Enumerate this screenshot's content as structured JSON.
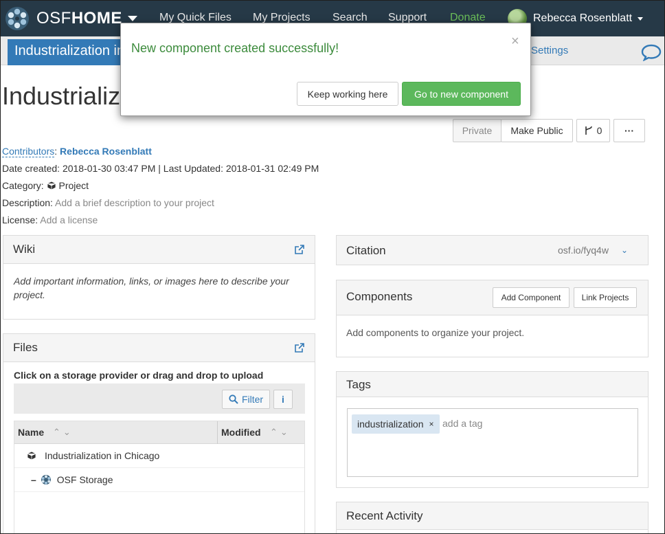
{
  "navbar": {
    "brand_prefix": "OSF",
    "brand_suffix": "HOME",
    "links": {
      "quick_files": "My Quick Files",
      "projects": "My Projects",
      "search": "Search",
      "support": "Support",
      "donate": "Donate"
    },
    "user_name": "Rebecca Rosenblatt"
  },
  "project_nav": {
    "project_tab": "Industrialization in Chicago",
    "settings": "Settings"
  },
  "project": {
    "title": "Industrialization in Chicago",
    "privacy": {
      "private_label": "Private",
      "make_public_label": "Make Public"
    },
    "fork_count": "0",
    "more_label": "···",
    "contributors_label": "Contributors",
    "contributor_name": "Rebecca Rosenblatt",
    "dates_line": "Date created: 2018-01-30 03:47 PM | Last Updated: 2018-01-31 02:49 PM",
    "category_label": "Category:",
    "category_value": "Project",
    "description_label": "Description:",
    "description_placeholder": "Add a brief description to your project",
    "license_label": "License:",
    "license_placeholder": "Add a license"
  },
  "wiki": {
    "title": "Wiki",
    "body": "Add important information, links, or images here to describe your project."
  },
  "files": {
    "title": "Files",
    "hint": "Click on a storage provider or drag and drop to upload",
    "filter_label": "Filter",
    "info_label": "i",
    "columns": {
      "name": "Name",
      "modified": "Modified"
    },
    "rows": [
      {
        "name": "Industrialization in Chicago"
      },
      {
        "toggle": "–",
        "name": "OSF Storage"
      }
    ]
  },
  "citation": {
    "title": "Citation",
    "url": "osf.io/fyq4w"
  },
  "components": {
    "title": "Components",
    "add_label": "Add Component",
    "link_label": "Link Projects",
    "empty": "Add components to organize your project."
  },
  "tags": {
    "title": "Tags",
    "items": [
      "industrialization"
    ],
    "remove_glyph": "×",
    "placeholder": "add a tag"
  },
  "recent_activity": {
    "title": "Recent Activity"
  },
  "modal": {
    "message": "New component created successfully!",
    "close_glyph": "×",
    "keep_label": "Keep working here",
    "go_label": "Go to new component"
  },
  "colors": {
    "navbar_bg": "#263947",
    "accent_blue": "#337ab7",
    "success_green": "#5cb85c",
    "donate_green": "#6bbf59"
  }
}
